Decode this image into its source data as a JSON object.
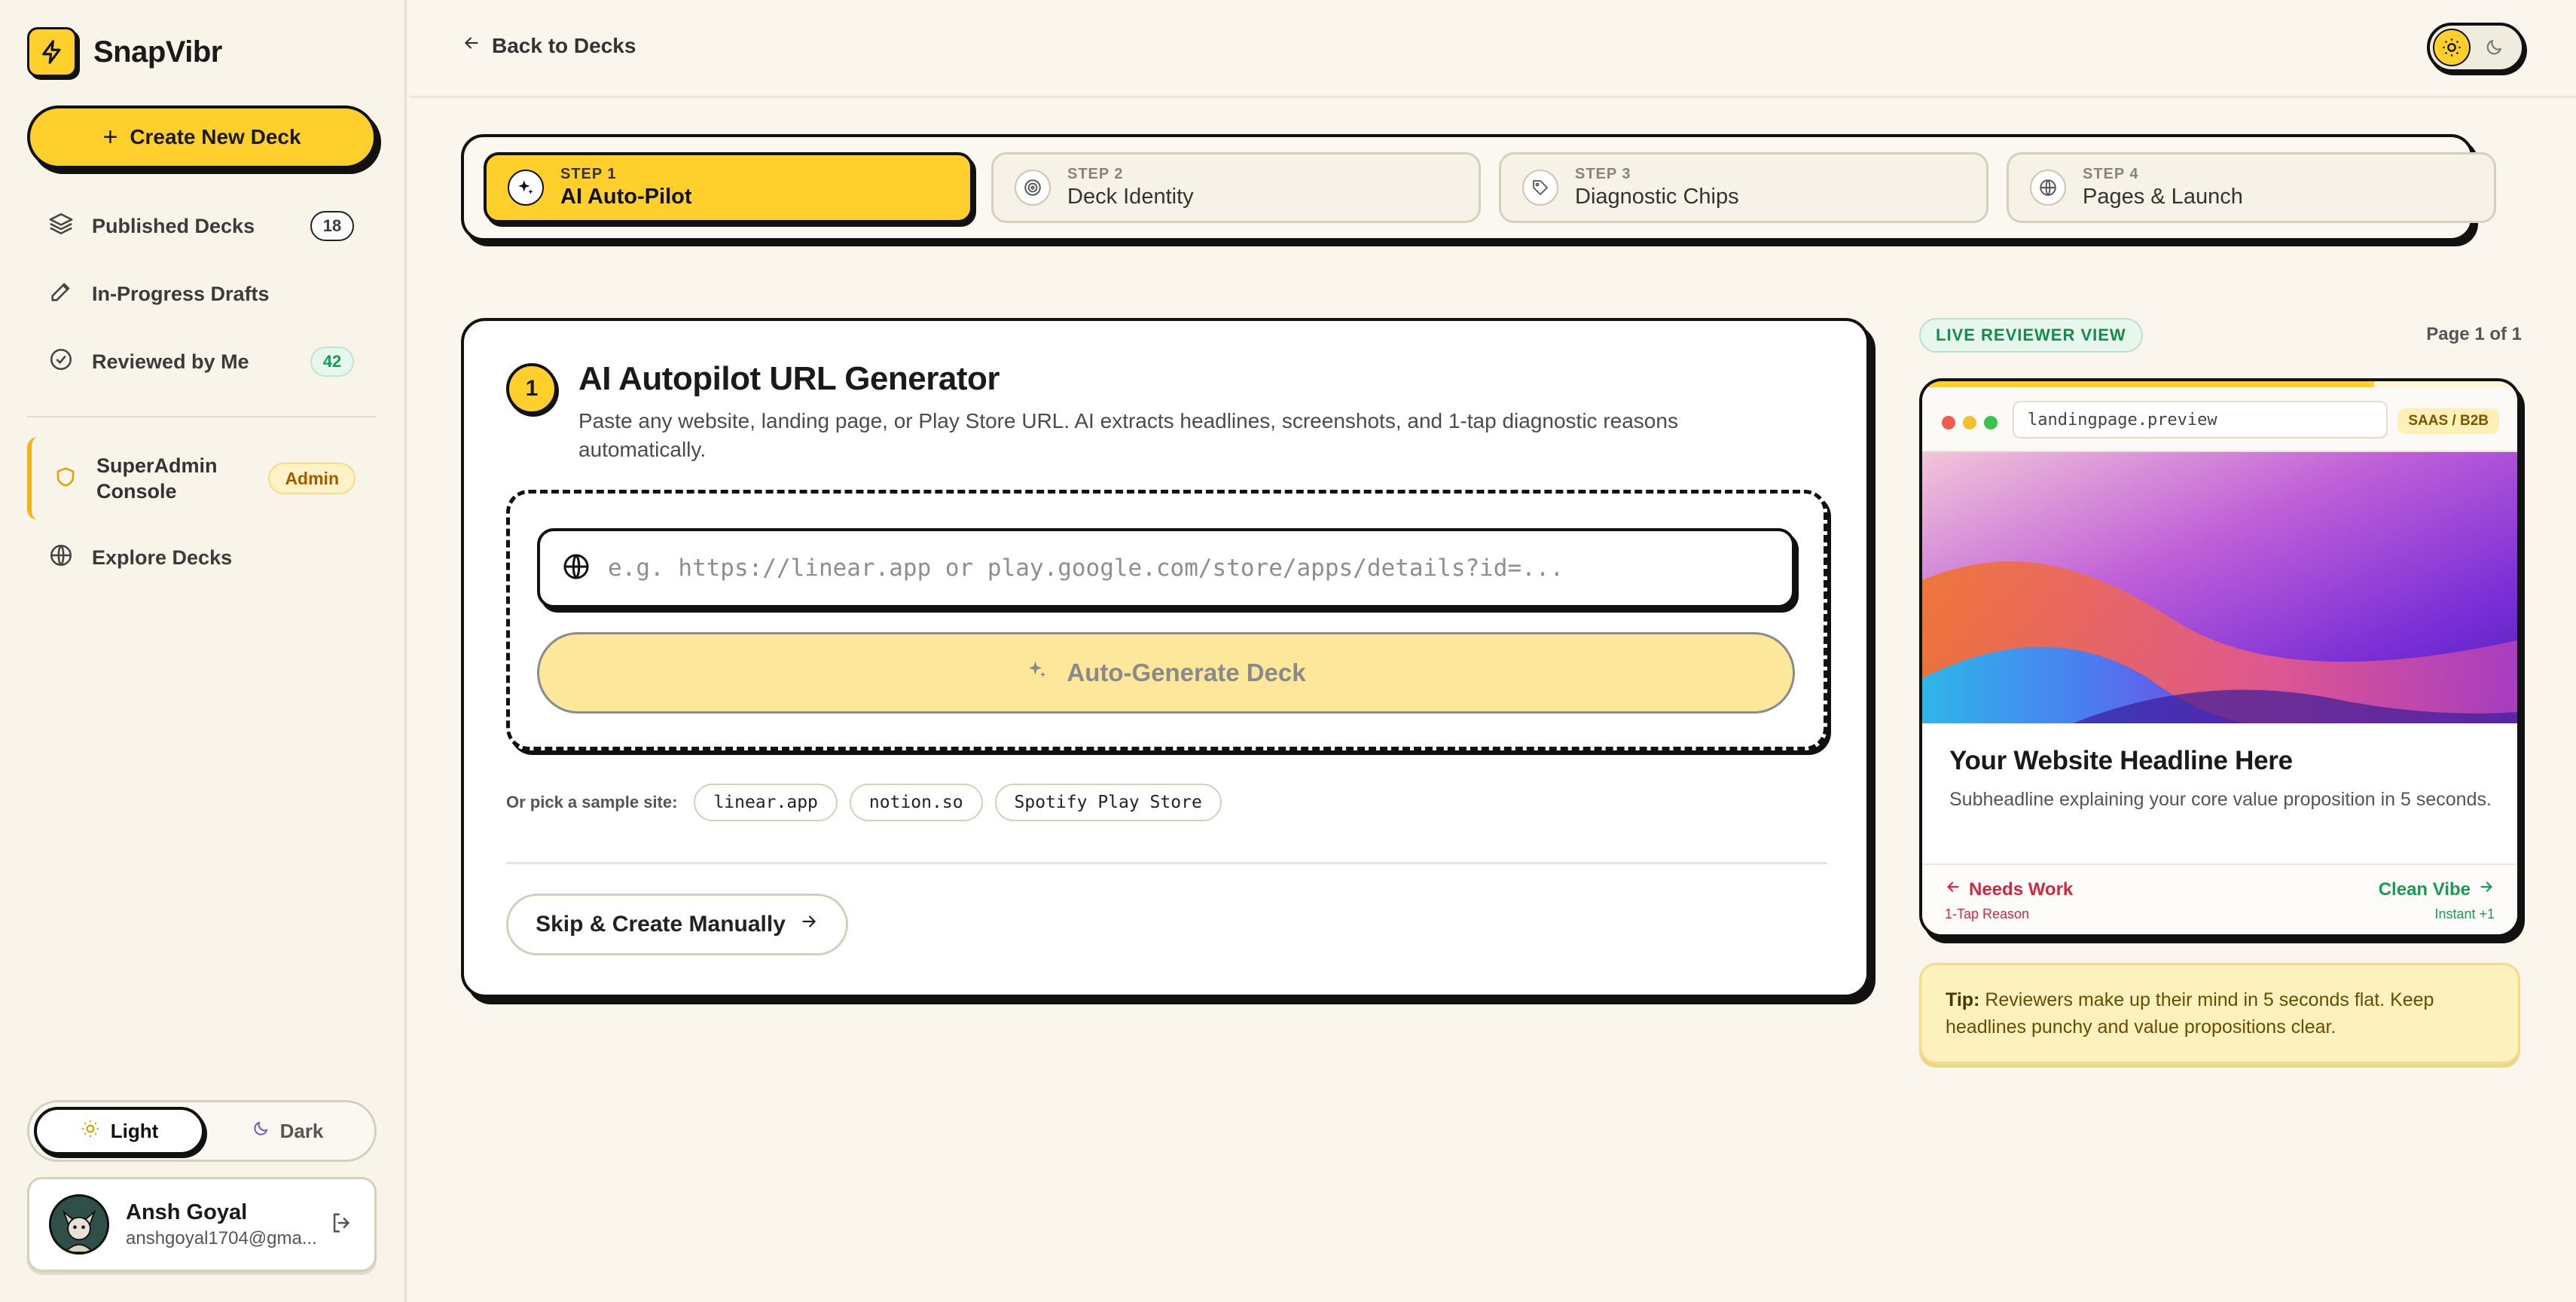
{
  "app": {
    "name": "SnapVibr"
  },
  "sidebar": {
    "create_label": "Create New Deck",
    "items": [
      {
        "label": "Published Decks",
        "badge": "18"
      },
      {
        "label": "In-Progress Drafts"
      },
      {
        "label": "Reviewed by Me",
        "badge": "42"
      }
    ],
    "admin": {
      "label": "SuperAdmin Console",
      "badge": "Admin"
    },
    "explore_label": "Explore Decks",
    "theme": {
      "light": "Light",
      "dark": "Dark",
      "selected": "Light"
    },
    "user": {
      "name": "Ansh Goyal",
      "email": "anshgoyal1704@gma..."
    }
  },
  "header": {
    "back_label": "Back to Decks"
  },
  "steps": [
    {
      "num": "STEP 1",
      "title": "AI Auto-Pilot",
      "active": true
    },
    {
      "num": "STEP 2",
      "title": "Deck Identity"
    },
    {
      "num": "STEP 3",
      "title": "Diagnostic Chips"
    },
    {
      "num": "STEP 4",
      "title": "Pages & Launch"
    }
  ],
  "main": {
    "step_number": "1",
    "title": "AI Autopilot URL Generator",
    "description": "Paste any website, landing page, or Play Store URL. AI extracts headlines, screenshots, and 1-tap diagnostic reasons automatically.",
    "url_placeholder": "e.g. https://linear.app or play.google.com/store/apps/details?id=...",
    "url_value": "",
    "generate_label": "Auto-Generate Deck",
    "samples_label": "Or pick a sample site:",
    "samples": [
      "linear.app",
      "notion.so",
      "Spotify Play Store"
    ],
    "skip_label": "Skip & Create Manually"
  },
  "preview": {
    "badge": "LIVE REVIEWER VIEW",
    "page_info": "Page 1 of 1",
    "address": "landingpage.preview",
    "tag": "SAAS / B2B",
    "headline": "Your Website Headline Here",
    "subheadline": "Subheadline explaining your core value proposition in 5 seconds.",
    "left_vote": {
      "label": "Needs Work",
      "sub": "1-Tap Reason"
    },
    "right_vote": {
      "label": "Clean Vibe",
      "sub": "Instant +1"
    },
    "progress": 0.76
  },
  "tip": {
    "prefix": "Tip:",
    "text": "Reviewers make up their mind in 5 seconds flat. Keep headlines punchy and value propositions clear."
  },
  "colors": {
    "accent": "#ffd02b",
    "background": "#faf6ee",
    "success": "#1a9a52",
    "danger": "#d3263f"
  }
}
